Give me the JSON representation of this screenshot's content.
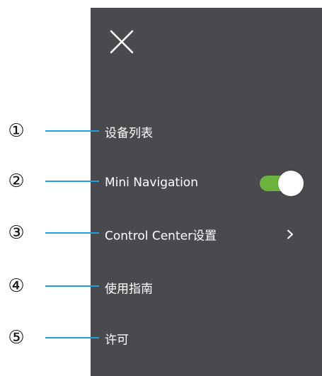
{
  "menu": {
    "close_label": "close",
    "items": [
      {
        "label": "设备列表"
      },
      {
        "label": "Mini Navigation",
        "toggle_on": true
      },
      {
        "label": "Control Center设置"
      },
      {
        "label": "使用指南"
      },
      {
        "label": "许可"
      }
    ]
  },
  "callouts": [
    "①",
    "②",
    "③",
    "④",
    "⑤"
  ],
  "colors": {
    "panel_bg": "#4a494e",
    "text": "#ffffff",
    "toggle_on": "#6cb33e",
    "callout_line": "#1e9fe0",
    "callout_text": "#111111"
  },
  "icons": {
    "close": "close-icon",
    "chevron": "chevron-right-icon"
  }
}
